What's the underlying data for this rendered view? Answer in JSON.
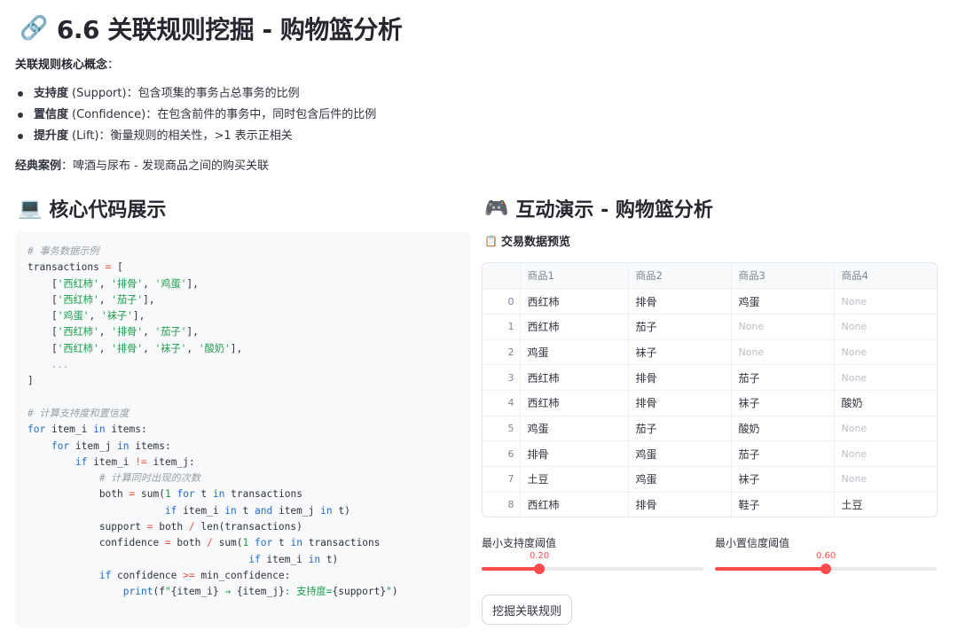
{
  "header": {
    "icon": "link-icon",
    "title": "6.6 关联规则挖掘 - 购物篮分析"
  },
  "concepts": {
    "label": "关联规则核心概念",
    "items": [
      {
        "term": "支持度",
        "en": "(Support)",
        "desc": "：包含项集的事务占总事务的比例"
      },
      {
        "term": "置信度",
        "en": "(Confidence)",
        "desc": "：在包含前件的事务中，同时包含后件的比例"
      },
      {
        "term": "提升度",
        "en": "(Lift)",
        "desc": "：衡量规则的相关性，>1 表示正相关"
      }
    ],
    "case_label": "经典案例",
    "case_text": "：啤酒与尿布 - 发现商品之间的购买关联"
  },
  "code_section": {
    "icon": "laptop-icon",
    "title": "核心代码展示"
  },
  "demo_section": {
    "icon": "gamepad-icon",
    "title": "互动演示 - 购物篮分析",
    "preview_icon": "clipboard-icon",
    "preview_label": "交易数据预览"
  },
  "table": {
    "columns": [
      "商品1",
      "商品2",
      "商品3",
      "商品4"
    ],
    "rows": [
      {
        "index": "0",
        "cells": [
          "西红柿",
          "排骨",
          "鸡蛋",
          "None"
        ]
      },
      {
        "index": "1",
        "cells": [
          "西红柿",
          "茄子",
          "None",
          "None"
        ]
      },
      {
        "index": "2",
        "cells": [
          "鸡蛋",
          "袜子",
          "None",
          "None"
        ]
      },
      {
        "index": "3",
        "cells": [
          "西红柿",
          "排骨",
          "茄子",
          "None"
        ]
      },
      {
        "index": "4",
        "cells": [
          "西红柿",
          "排骨",
          "袜子",
          "酸奶"
        ]
      },
      {
        "index": "5",
        "cells": [
          "鸡蛋",
          "茄子",
          "酸奶",
          "None"
        ]
      },
      {
        "index": "6",
        "cells": [
          "排骨",
          "鸡蛋",
          "茄子",
          "None"
        ]
      },
      {
        "index": "7",
        "cells": [
          "土豆",
          "鸡蛋",
          "袜子",
          "None"
        ]
      },
      {
        "index": "8",
        "cells": [
          "西红柿",
          "排骨",
          "鞋子",
          "土豆"
        ]
      }
    ]
  },
  "sliders": {
    "support": {
      "label": "最小支持度阈值",
      "value": "0.20",
      "fraction": 0.26
    },
    "confidence": {
      "label": "最小置信度阈值",
      "value": "0.60",
      "fraction": 0.5
    }
  },
  "button": {
    "label": "挖掘关联规则"
  },
  "colors": {
    "accent": "#ff4b4b",
    "code_bg": "#f8f9fb",
    "keyword": "#1f6bd1",
    "string": "#1a9c48",
    "comment": "#9aa0a6"
  }
}
